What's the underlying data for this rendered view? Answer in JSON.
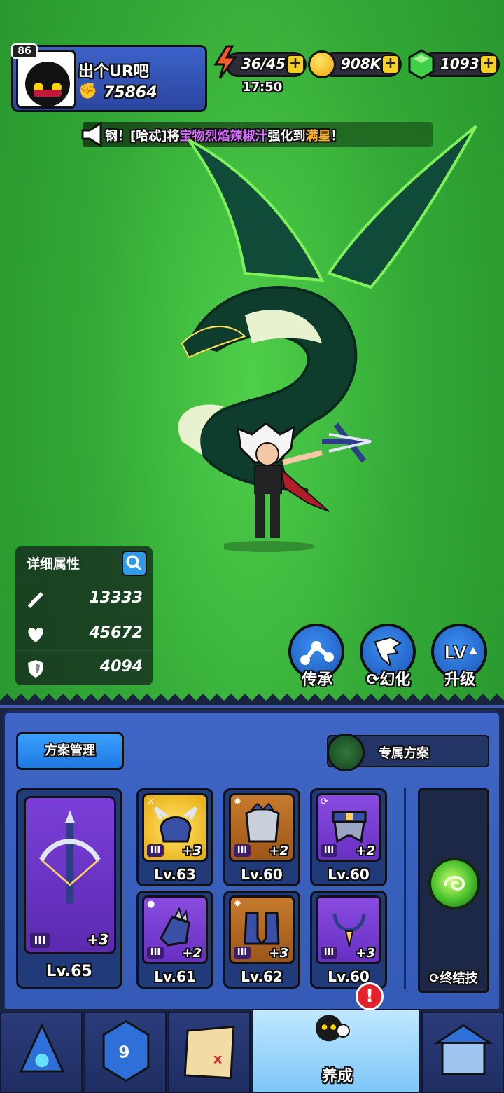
{
  "player": {
    "level": "86",
    "name": "出个UR吧",
    "power": "75864"
  },
  "resources": {
    "energy": "36/45",
    "energy_timer": "17:50",
    "coins": "908K",
    "gems": "1093",
    "plus_label": "+"
  },
  "broadcast": {
    "prefix": "钢！[哈忒]将",
    "item": "宝物烈焰辣椒汁",
    "middle": "强化到",
    "result": "满星",
    "suffix": "！"
  },
  "stats": {
    "title": "详细属性",
    "attack": "13333",
    "health": "45672",
    "defense": "4094"
  },
  "actions": {
    "inherit": "传承",
    "transform": "幻化",
    "upgrade": "升级"
  },
  "panel": {
    "plan_button": "方案管理",
    "exclusive_plan": "专属方案",
    "weapon": {
      "tier": "III",
      "plus": "+3",
      "level": "Lv.65"
    },
    "gear": [
      {
        "tier": "III",
        "plus": "+3",
        "level": "Lv.63",
        "rarity": "gold"
      },
      {
        "tier": "III",
        "plus": "+2",
        "level": "Lv.60",
        "rarity": "orange"
      },
      {
        "tier": "III",
        "plus": "+2",
        "level": "Lv.60",
        "rarity": "purple"
      },
      {
        "tier": "III",
        "plus": "+2",
        "level": "Lv.61",
        "rarity": "purple"
      },
      {
        "tier": "III",
        "plus": "+3",
        "level": "Lv.62",
        "rarity": "orange"
      },
      {
        "tier": "III",
        "plus": "+3",
        "level": "Lv.60",
        "rarity": "purple"
      }
    ],
    "ultimate_label": "终结技"
  },
  "nav": {
    "active_label": "养成",
    "alert": "!"
  },
  "colors": {
    "background": "#33a936",
    "panel": "#3f66c6",
    "gold": "#f5d020",
    "purple": "#7b3fd8"
  }
}
